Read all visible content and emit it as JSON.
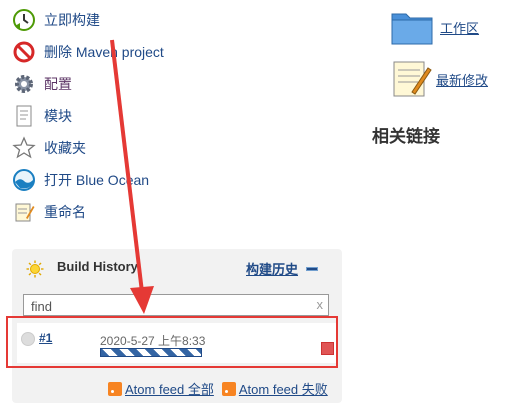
{
  "tasks": [
    {
      "label": "立即构建",
      "icon": "build-clock-icon"
    },
    {
      "label": "删除 Maven project",
      "icon": "no-entry-icon"
    },
    {
      "label": "配置",
      "icon": "gear-icon"
    },
    {
      "label": "模块",
      "icon": "document-icon"
    },
    {
      "label": "收藏夹",
      "icon": "star-icon"
    },
    {
      "label": "打开 Blue Ocean",
      "icon": "blue-ocean-icon"
    },
    {
      "label": "重命名",
      "icon": "notepad-icon"
    }
  ],
  "workspace": {
    "label": "工作区",
    "icon": "folder-icon"
  },
  "changes": {
    "label": "最新修改",
    "icon": "notepad-pencil-icon"
  },
  "related": {
    "title": "相关链接"
  },
  "build_history": {
    "title": "Build History",
    "trend_link": "构建历史",
    "search": {
      "value": "find",
      "clear": "x"
    },
    "builds": [
      {
        "number": "#1",
        "date": "2020-5-27 上午8:33"
      }
    ],
    "feeds": [
      {
        "label": "Atom feed 全部"
      },
      {
        "label": "Atom feed 失败"
      }
    ]
  },
  "colors": {
    "link": "#204a87",
    "annotation": "#e53935",
    "rss": "#f78422"
  }
}
